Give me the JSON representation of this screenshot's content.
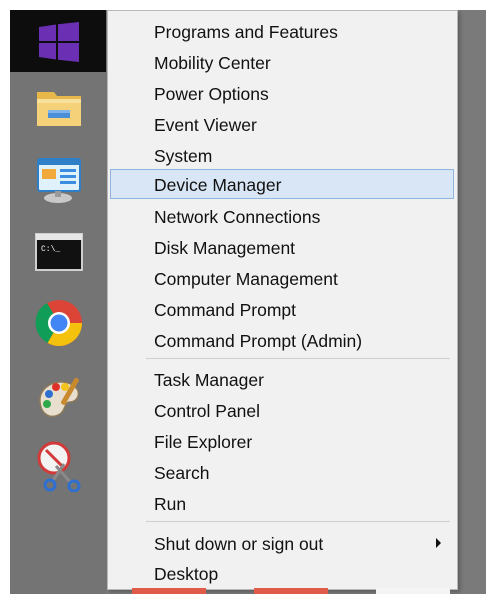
{
  "menu": {
    "items": [
      {
        "label": "Programs and Features"
      },
      {
        "label": "Mobility Center"
      },
      {
        "label": "Power Options"
      },
      {
        "label": "Event Viewer"
      },
      {
        "label": "System"
      },
      {
        "label": "Device Manager"
      },
      {
        "label": "Network Connections"
      },
      {
        "label": "Disk Management"
      },
      {
        "label": "Computer Management"
      },
      {
        "label": "Command Prompt"
      },
      {
        "label": "Command Prompt (Admin)"
      },
      {
        "label": "Task Manager"
      },
      {
        "label": "Control Panel"
      },
      {
        "label": "File Explorer"
      },
      {
        "label": "Search"
      },
      {
        "label": "Run"
      },
      {
        "label": "Shut down or sign out"
      },
      {
        "label": "Desktop"
      }
    ],
    "highlighted_item": "Device Manager",
    "submenu_item": "Shut down or sign out"
  },
  "taskbar": {
    "icons": [
      "windows-start-icon",
      "file-explorer-icon",
      "control-panel-icon",
      "command-prompt-icon",
      "chrome-icon",
      "paint-icon",
      "snipping-tool-icon"
    ]
  },
  "colors": {
    "highlight_background": "#d8e6f5",
    "highlight_border": "#91b4dc",
    "menu_background": "#f1f1f1",
    "start_tile": "#0d0d0d",
    "windows_logo": "#6b2fb3"
  }
}
